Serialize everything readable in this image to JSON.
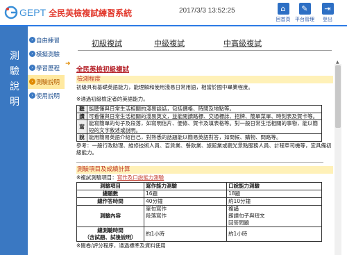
{
  "header": {
    "logo_text": "GEPT",
    "logo_sub": "全民英檢複試練習系統",
    "datetime": "2017/3/3 13:52:25",
    "buttons": [
      {
        "label": "回首頁",
        "icon": "home-icon"
      },
      {
        "label": "平台管理",
        "icon": "wrench-icon"
      },
      {
        "label": "登出",
        "icon": "logout-icon"
      }
    ]
  },
  "sidebar": {
    "title": "測驗說明",
    "items": [
      {
        "label": "自由練習"
      },
      {
        "label": "模擬測驗"
      },
      {
        "label": "學習歷程"
      },
      {
        "label": "測驗說明"
      },
      {
        "label": "使用說明"
      }
    ]
  },
  "tabs": [
    "初級複試",
    "中級複試",
    "中高級複試"
  ],
  "content": {
    "title": "全民英檢初級複試",
    "band1": "檢測程度",
    "intro": "初級具有基礎英語能力，能理解和使用淺易日常用語，相當於國中畢業程度。",
    "note1": "※通過初級檢定者的英語能力。",
    "abilities": [
      {
        "k": "聽",
        "t": "能聽懂與日常生活相關的淺易談話，包括價格、時間及地點等。"
      },
      {
        "k": "讀",
        "t": "可看懂與日常生活相關的淺易英文，並能閱讀路標、交通標誌、招牌、簡單菜單、時刻表及賀卡等。"
      },
      {
        "k": "寫",
        "t": "能寫簡單的句子及段落，如寫明信片、便條、賀卡及填表格等。對一般日常生活相關的事物，能以簡短的文字敘述或說明。"
      },
      {
        "k": "說",
        "t": "能用簡易英語介紹自己，對熟悉的話題能以簡易英語對答，如問候、購物、問路等。"
      }
    ],
    "ref": "參考：一般行政助理、維修技術人員、百貨業、餐飲業、旅館業或觀光景點服務人員、計程車司機等，宜具備初級能力。",
    "band2": "測驗項目及成績計算",
    "note2_prefix": "※複試測驗項目：",
    "note2_red": "寫作及口說能力測驗",
    "table": {
      "headers": [
        "測驗項目",
        "寫作能力測驗",
        "口說能力測驗"
      ],
      "rows": [
        {
          "h": "總題數",
          "a": "16題",
          "b": "18題"
        },
        {
          "h": "總作答時間",
          "a": "40分鐘",
          "b": "約10分鐘"
        },
        {
          "h": "測驗內容",
          "a": "單句寫作\n段落寫作",
          "b": "複誦\n朗讀句子與短文\n回答問題"
        },
        {
          "h": "總測驗時間\n（含試題、試後說明）",
          "a": "約1小時",
          "b": "約1小時"
        }
      ]
    },
    "footer_note": "※閱卷/評分程序，通過標準及資料使用"
  },
  "colors": {
    "accent": "#2c7be5",
    "sidebar": "#3a78c2",
    "highlight": "#fff1b8",
    "title_red": "#b5232a"
  }
}
